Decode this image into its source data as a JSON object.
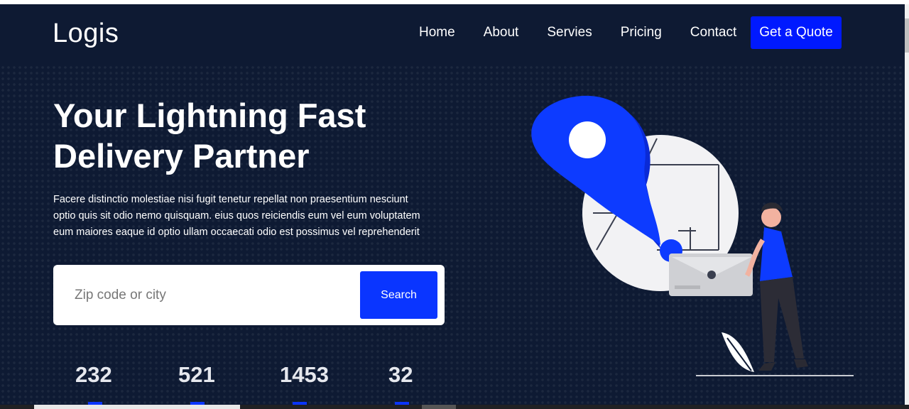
{
  "brand": {
    "logo": "Logis"
  },
  "nav": {
    "items": [
      {
        "label": "Home"
      },
      {
        "label": "About"
      },
      {
        "label": "Servies"
      },
      {
        "label": "Pricing"
      },
      {
        "label": "Contact"
      }
    ],
    "cta": "Get a Quote"
  },
  "hero": {
    "title_line1": "Your Lightning Fast",
    "title_line2": "Delivery Partner",
    "desc_line1": "Facere distinctio molestiae nisi fugit tenetur repellat non praesentium nesciunt",
    "desc_line2": "optio quis sit odio nemo quisquam. eius quos reiciendis eum vel eum voluptatem",
    "desc_line3": "eum maiores eaque id optio ullam occaecati odio est possimus vel reprehenderit"
  },
  "search": {
    "placeholder": "Zip code or city",
    "value": "",
    "button_label": "Search"
  },
  "stats": [
    {
      "value": "232"
    },
    {
      "value": "521"
    },
    {
      "value": "1453"
    },
    {
      "value": "32"
    }
  ],
  "colors": {
    "background": "#0e1a33",
    "accent": "#0a35ff",
    "quote_button": "#0019ff",
    "text": "#ffffff"
  },
  "icons": {
    "illustration": "delivery-person-map-pin-illustration"
  }
}
